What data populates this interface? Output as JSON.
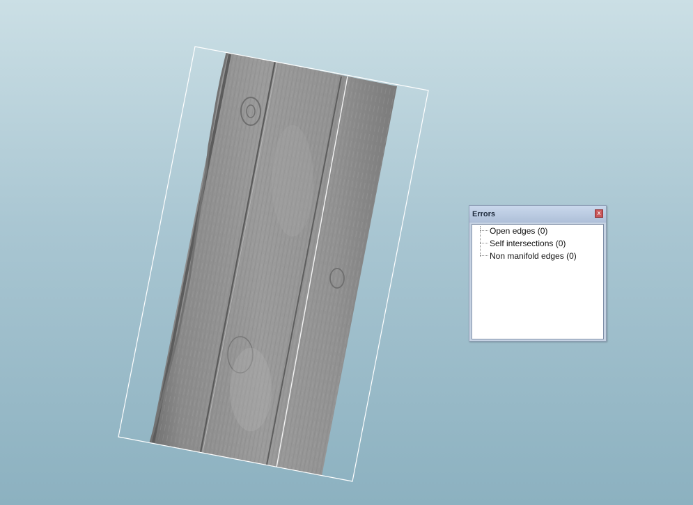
{
  "viewport": {
    "background_top": "#cbdfe5",
    "background_bottom": "#8cb1c0",
    "model": "wood-plank-mesh",
    "model_color": "#8f8f8f",
    "selection_box_color": "#ffffff"
  },
  "errors_panel": {
    "title": "Errors",
    "close_glyph": "x",
    "items": [
      {
        "label": "Open edges (0)"
      },
      {
        "label": "Self intersections (0)"
      },
      {
        "label": "Non manifold edges (0)"
      }
    ]
  }
}
